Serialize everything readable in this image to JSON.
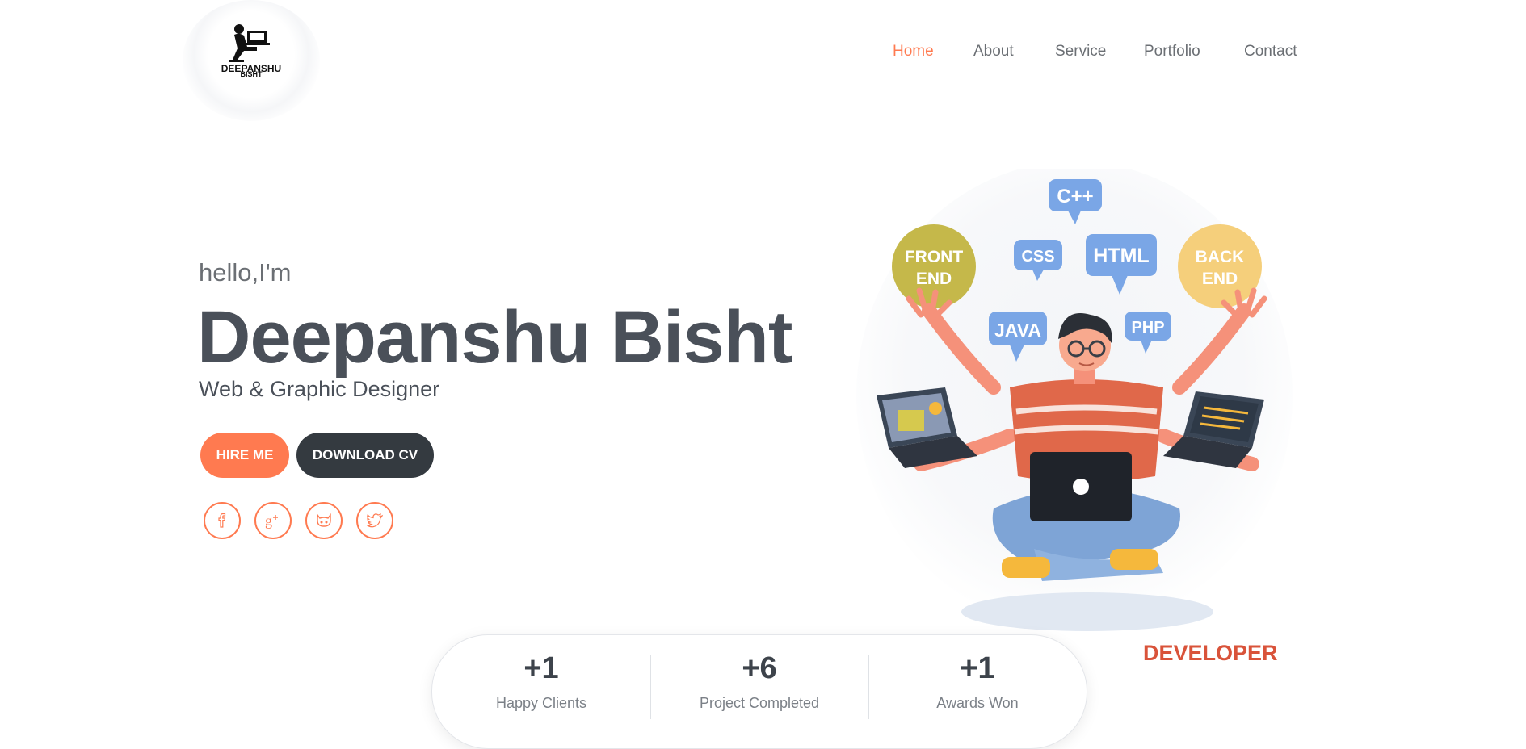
{
  "logo": {
    "line1": "DEEPANSHU",
    "line2": "BISHT"
  },
  "nav": {
    "items": [
      {
        "label": "Home",
        "active": true
      },
      {
        "label": "About",
        "active": false
      },
      {
        "label": "Service",
        "active": false
      },
      {
        "label": "Portfolio",
        "active": false
      },
      {
        "label": "Contact",
        "active": false
      }
    ]
  },
  "hero": {
    "greeting": "hello,I'm",
    "name": "Deepanshu Bisht",
    "role": "Web & Graphic Designer",
    "hire_label": "HIRE ME",
    "cv_label": "DOWNLOAD CV"
  },
  "social": [
    {
      "icon": "facebook-icon"
    },
    {
      "icon": "google-plus-icon"
    },
    {
      "icon": "github-icon"
    },
    {
      "icon": "twitter-icon"
    }
  ],
  "illustration": {
    "bubbles": {
      "cpp": "C++",
      "css": "CSS",
      "html": "HTML",
      "java": "JAVA",
      "php": "PHP"
    },
    "circles": {
      "front_line1": "FRONT",
      "front_line2": "END",
      "back_line1": "BACK",
      "back_line2": "END"
    },
    "caption": "DEVELOPER"
  },
  "stats": [
    {
      "value": "+1",
      "label": "Happy Clients"
    },
    {
      "value": "+6",
      "label": "Project Completed"
    },
    {
      "value": "+1",
      "label": "Awards Won"
    }
  ],
  "colors": {
    "accent": "#ff7a50",
    "dark": "#343a40",
    "text": "#4a5059",
    "muted": "#6b6f74",
    "bubble": "#7aa6e6"
  }
}
